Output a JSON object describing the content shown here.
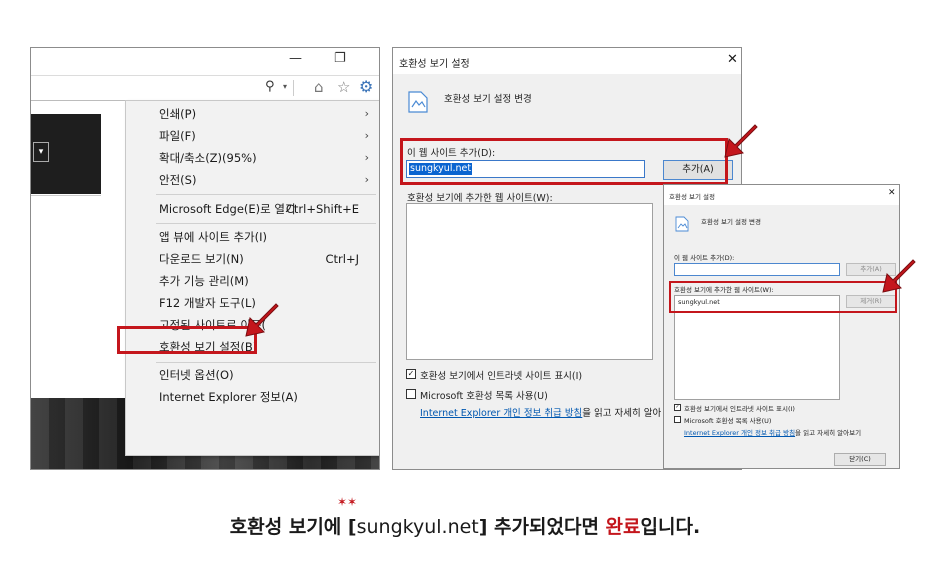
{
  "ie_menu": {
    "items_group1": [
      {
        "label": "인쇄(P)",
        "arrow": "›"
      },
      {
        "label": "파일(F)",
        "arrow": "›"
      },
      {
        "label": "확대/축소(Z)(95%)",
        "arrow": "›"
      },
      {
        "label": "안전(S)",
        "arrow": "›"
      }
    ],
    "edge_item": {
      "label": "Microsoft Edge(E)로 열기",
      "shortcut": "Ctrl+Shift+E"
    },
    "items_group3": [
      {
        "label": "앱 뷰에 사이트 추가(I)",
        "shortcut": ""
      },
      {
        "label": "다운로드 보기(N)",
        "shortcut": "Ctrl+J"
      },
      {
        "label": "추가 기능 관리(M)",
        "shortcut": ""
      },
      {
        "label": "F12 개발자 도구(L)",
        "shortcut": ""
      },
      {
        "label": "고정된 사이트로 이동(",
        "shortcut": ""
      },
      {
        "label": "호환성 보기 설정(B)",
        "shortcut": ""
      }
    ],
    "items_group4": [
      {
        "label": "인터넷 옵션(O)"
      },
      {
        "label": "Internet Explorer 정보(A)"
      }
    ]
  },
  "compat_dialog": {
    "title": "호환성 보기 설정",
    "header": "호환성 보기 설정 변경",
    "add_label": "이 웹 사이트 추가(D):",
    "input_value": "sungkyul.net",
    "add_button": "추가(A)",
    "list_label": "호환성 보기에 추가한 웹 사이트(W):",
    "intranet_checkbox": "호환성 보기에서 인트라넷 사이트 표시(I)",
    "ms_list_checkbox": "Microsoft 호환성 목록 사용(U)",
    "privacy_link": "Internet Explorer 개인 정보 취급 방침",
    "privacy_suffix": "을 읽고 자세히 알아"
  },
  "small_dialog": {
    "title": "호환성 보기 설정",
    "header": "호환성 보기 설정 변경",
    "add_label": "이 웹 사이트 추가(D):",
    "add_button": "추가(A)",
    "list_label": "호환성 보기에 추가한 웹 사이트(W):",
    "list_item": "sungkyul.net",
    "remove_button": "제거(R)",
    "intranet_checkbox": "호환성 보기에서 인트라넷 사이트 표시(I)",
    "ms_list_checkbox": "Microsoft 호환성 목록 사용(U)",
    "privacy_link": "Internet Explorer 개인 정보 취급 방침",
    "privacy_suffix": "을 읽고 자세히 알아보기",
    "close_button": "닫기(C)"
  },
  "caption": {
    "part1": "호환성 보기에 [",
    "site": "sungkyul.net",
    "part2": "] 추가되었다면 ",
    "highlight": "완료",
    "part3": "입니다."
  },
  "colors": {
    "accent_red": "#c4161c",
    "selection_blue": "#0a64d0",
    "link_blue": "#0057b0"
  }
}
